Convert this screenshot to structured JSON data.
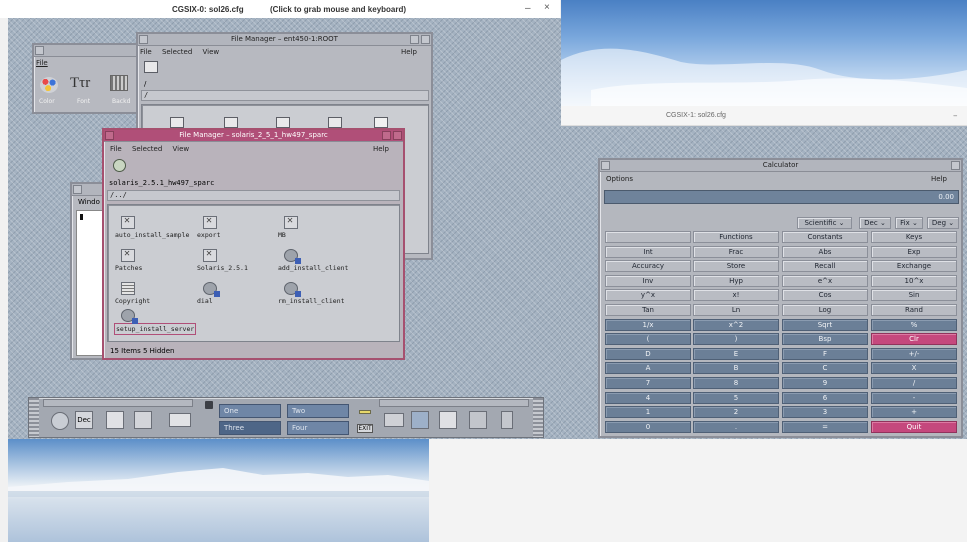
{
  "host_window_0": {
    "title": "CGSIX-0: sol26.cfg",
    "hint": "(Click to grab mouse and keyboard)",
    "minimize": "–",
    "close": "×"
  },
  "host_window_1": {
    "title": "CGSIX-1: sol26.cfg",
    "minimize": "–"
  },
  "app_manager": {
    "menu_file": "File",
    "items": [
      "Color",
      "Font",
      "Backd"
    ]
  },
  "fm_root": {
    "title": "File Manager – ent450-1:ROOT",
    "menu": [
      "File",
      "Selected",
      "View"
    ],
    "help": "Help",
    "path": "/",
    "path2": "/"
  },
  "fm_solaris": {
    "title": "File Manager – solaris_2_5_1_hw497_sparc",
    "menu": [
      "File",
      "Selected",
      "View"
    ],
    "help": "Help",
    "folder_name": "solaris_2.5.1_hw497_sparc",
    "path": "/../",
    "items": [
      {
        "name": "auto_install_sample",
        "icon": "x"
      },
      {
        "name": "export",
        "icon": "x"
      },
      {
        "name": "MB",
        "icon": "x"
      },
      {
        "name": "Patches",
        "icon": "x"
      },
      {
        "name": "Solaris_2.5.1",
        "icon": "x"
      },
      {
        "name": "add_install_client",
        "icon": "gear"
      },
      {
        "name": "Copyright",
        "icon": "doc"
      },
      {
        "name": "dial",
        "icon": "gear"
      },
      {
        "name": "rm_install_client",
        "icon": "gear"
      },
      {
        "name": "setup_install_server",
        "icon": "gear"
      }
    ],
    "status": "15 Items 5 Hidden"
  },
  "small_window": {
    "menu": "Windo"
  },
  "calculator": {
    "title": "Calculator",
    "menu_options": "Options",
    "menu_help": "Help",
    "display": "0.00",
    "modes": [
      "Scientific",
      "Dec",
      "Fix",
      "Deg"
    ],
    "rows": [
      [
        "",
        "Functions",
        "Constants",
        "Keys"
      ],
      [
        "Int",
        "Frac",
        "Abs",
        "Exp"
      ],
      [
        "Accuracy",
        "Store",
        "Recall",
        "Exchange"
      ],
      [
        "Inv",
        "Hyp",
        "e^x",
        "10^x"
      ],
      [
        "y^x",
        "x!",
        "Cos",
        "Sin"
      ],
      [
        "Tan",
        "Ln",
        "Log",
        "Rand"
      ],
      [
        "1/x",
        "x^2",
        "Sqrt",
        "%"
      ],
      [
        "(",
        ")",
        "Bsp",
        "Clr"
      ],
      [
        "D",
        "E",
        "F",
        "+/-"
      ],
      [
        "A",
        "B",
        "C",
        "X"
      ],
      [
        "7",
        "8",
        "9",
        "/"
      ],
      [
        "4",
        "5",
        "6",
        "-"
      ],
      [
        "1",
        "2",
        "3",
        "+"
      ],
      [
        "0",
        ".",
        "=",
        "Quit"
      ]
    ]
  },
  "front_panel": {
    "workspaces": [
      "One",
      "Two",
      "Three",
      "Four"
    ],
    "clock_label": "Dec",
    "exit_label": "EXIT"
  },
  "colors": {
    "active_title": "#b04f78",
    "cde_backdrop": "#a4b2c1",
    "calc_dark_key": "#6b7f97",
    "calc_pink_key": "#c5487d"
  }
}
